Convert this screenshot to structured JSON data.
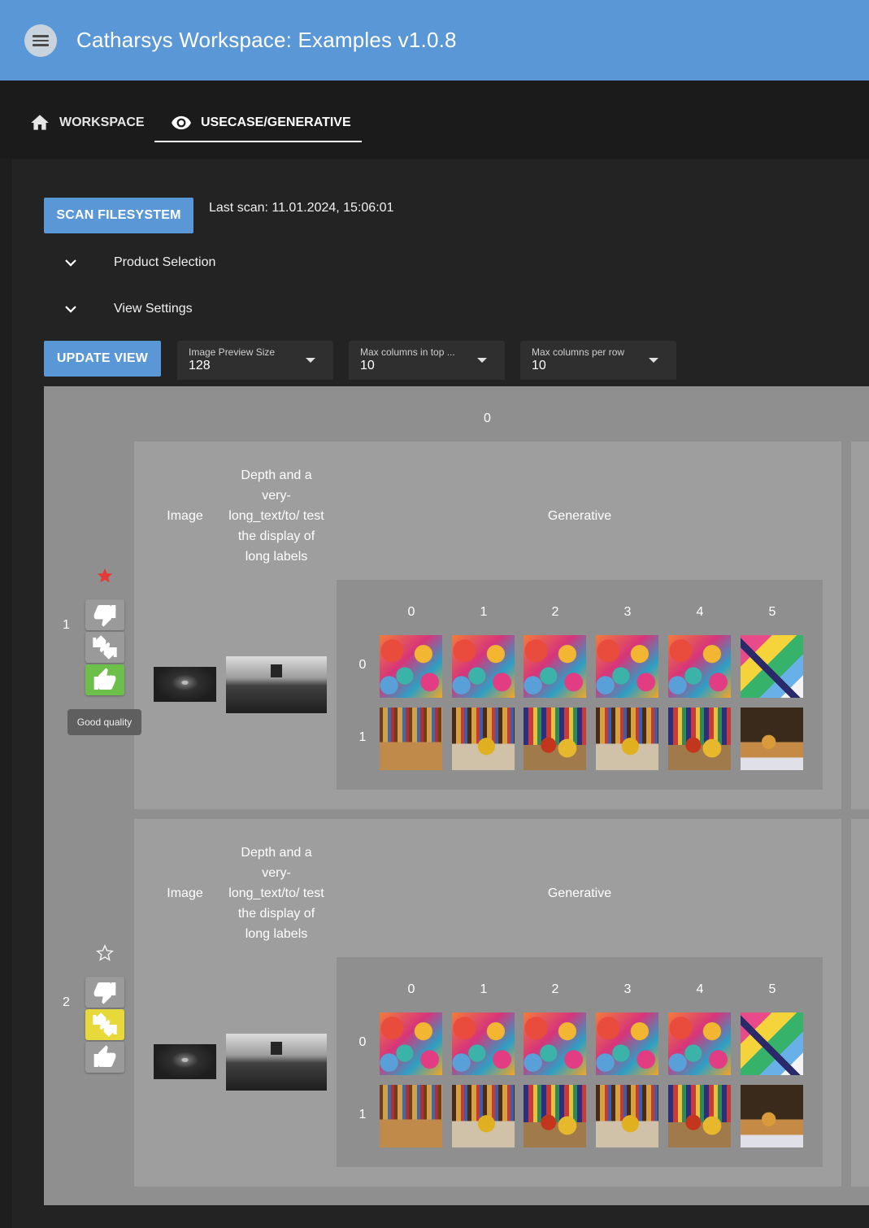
{
  "app": {
    "title": "Catharsys Workspace: Examples v1.0.8"
  },
  "tabs": [
    {
      "label": "WORKSPACE",
      "icon": "home-icon"
    },
    {
      "label": "USECASE/GENERATIVE",
      "icon": "eye-icon"
    }
  ],
  "toolbar": {
    "scan_label": "SCAN FILESYSTEM",
    "last_scan": "Last scan: 11.01.2024, 15:06:01",
    "update_label": "UPDATE VIEW"
  },
  "expanders": [
    {
      "label": "Product Selection",
      "icon": "chevron-down-icon"
    },
    {
      "label": "View Settings",
      "icon": "chevron-down-icon"
    }
  ],
  "selects": [
    {
      "label": "Image Preview Size",
      "value": "128"
    },
    {
      "label": "Max columns in top ...",
      "value": "10"
    },
    {
      "label": "Max columns per row",
      "value": "10"
    }
  ],
  "grid": {
    "top_column_header": "0",
    "rows": [
      {
        "index": "1",
        "starred": true,
        "vote_state": "good",
        "tooltip": "Good quality",
        "headers": {
          "image": "Image",
          "depth": "Depth and a very-long_text/to/ test the display of long labels",
          "generative": "Generative"
        },
        "col_headers": [
          "0",
          "1",
          "2",
          "3",
          "4",
          "5"
        ],
        "row_headers": [
          "0",
          "1"
        ]
      },
      {
        "index": "2",
        "starred": false,
        "vote_state": "medium",
        "headers": {
          "image": "Image",
          "depth": "Depth and a very-long_text/to/ test the display of long labels",
          "generative": "Generative"
        },
        "col_headers": [
          "0",
          "1",
          "2",
          "3",
          "4",
          "5"
        ],
        "row_headers": [
          "0",
          "1"
        ]
      }
    ]
  },
  "colors": {
    "appbar": "#5a97d6",
    "accent_button": "#5a97d6",
    "vote_good": "#6cc04a",
    "vote_medium": "#e8d93a",
    "star_active": "#e53935"
  }
}
